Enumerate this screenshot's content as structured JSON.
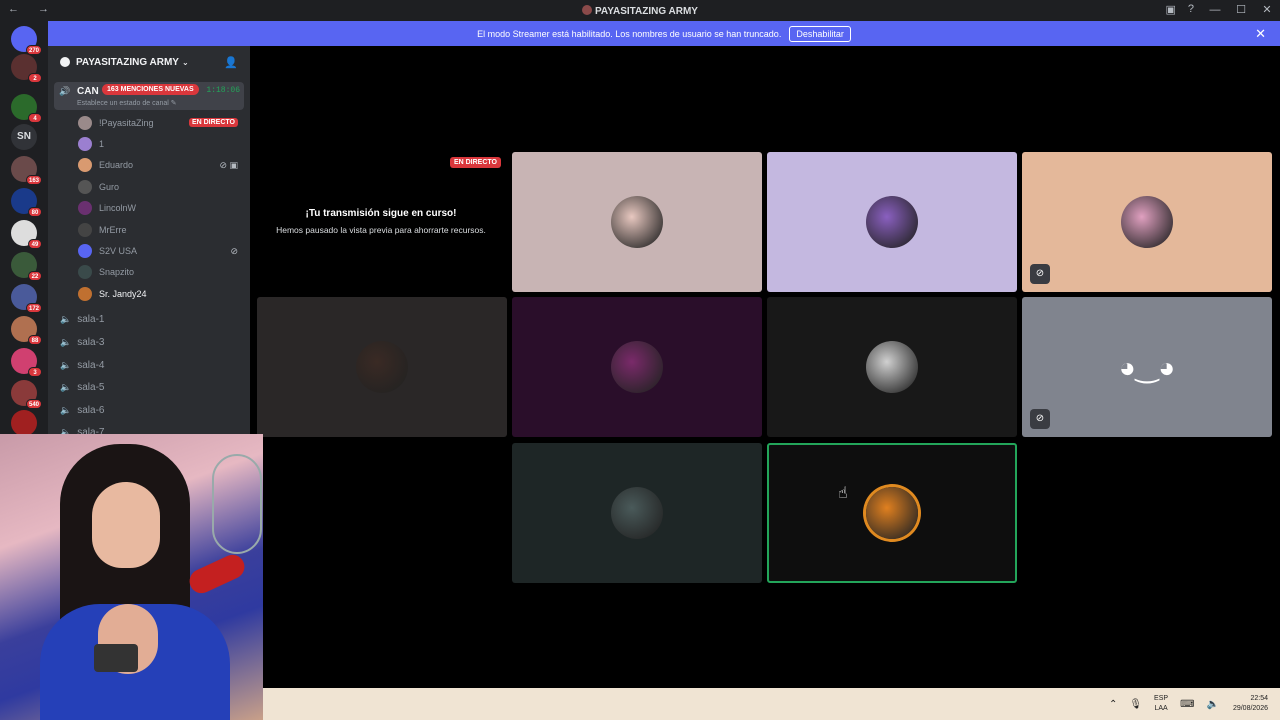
{
  "window": {
    "title": "PAYASITAZING ARMY",
    "nav": "← →"
  },
  "banner": {
    "text": "El modo Streamer está habilitado. Los nombres de usuario se han truncado.",
    "button": "Deshabilitar",
    "close": "✕"
  },
  "servers": [
    {
      "label": "",
      "badge": "270",
      "color": "#5865f2"
    },
    {
      "label": "",
      "badge": "2",
      "color": "#5a3030"
    },
    {
      "label": "",
      "badge": "4",
      "color": "#2b6a2b"
    },
    {
      "label": "SN",
      "badge": "",
      "color": "#313338"
    },
    {
      "label": "",
      "badge": "163",
      "color": "#6a4a4a"
    },
    {
      "label": "",
      "badge": "80",
      "color": "#1a3a8a"
    },
    {
      "label": "",
      "badge": "49",
      "color": "#dddddd"
    },
    {
      "label": "",
      "badge": "22",
      "color": "#3a5a3a"
    },
    {
      "label": "",
      "badge": "172",
      "color": "#4a5a9a"
    },
    {
      "label": "",
      "badge": "88",
      "color": "#b07050"
    },
    {
      "label": "",
      "badge": "3",
      "color": "#d04070"
    },
    {
      "label": "",
      "badge": "540",
      "color": "#8a3a3a"
    },
    {
      "label": "",
      "badge": "",
      "color": "#a02020"
    }
  ],
  "guild": {
    "name": "PAYASITAZING ARMY",
    "chevron": "⌄"
  },
  "active_channel": {
    "name": "CAN",
    "mentions": "163 MENCIONES NUEVAS",
    "timer": "1:18:06",
    "status": "Establece un estado de canal ✎"
  },
  "users": [
    {
      "name": "!PayasitaZing",
      "live": "EN DIRECTO",
      "icons": "",
      "color": "#9a8a8a"
    },
    {
      "name": "1",
      "live": "",
      "icons": "",
      "color": "#9b7fd0"
    },
    {
      "name": "Eduardo",
      "live": "",
      "icons": "⊘ ▣",
      "color": "#d99a70"
    },
    {
      "name": "Guro",
      "live": "",
      "icons": "",
      "color": "#555555"
    },
    {
      "name": "LincolnW",
      "live": "",
      "icons": "",
      "color": "#6a3070"
    },
    {
      "name": "MrErre",
      "live": "",
      "icons": "",
      "color": "#444444"
    },
    {
      "name": "S2V USA",
      "live": "",
      "icons": "⊘",
      "color": "#5865f2"
    },
    {
      "name": "Snapzito",
      "live": "",
      "icons": "",
      "color": "#3a4a4a"
    },
    {
      "name": "Sr. Jandy24",
      "live": "",
      "icons": "",
      "color": "#c07030"
    }
  ],
  "voice_channels": [
    "sala-1",
    "sala-3",
    "sala-4",
    "sala-5",
    "sala-6",
    "sala-7"
  ],
  "stream": {
    "badge": "EN DIRECTO",
    "heading": "¡Tu transmisión sigue en curso!",
    "subtext": "Hemos pausado la vista previa para ahorrarte recursos."
  },
  "tiles": [
    {
      "bg": "#c8b4b4",
      "avatar": "#e8c8c0",
      "muted": false,
      "speaking": false
    },
    {
      "bg": "#c4b8e0",
      "avatar": "#8a60c0",
      "muted": false,
      "speaking": false
    },
    {
      "bg": "#e4b89a",
      "avatar": "#e0a0c0",
      "muted": true,
      "speaking": false
    },
    {
      "bg": "#2a2727",
      "avatar": "#3a2a24",
      "muted": false,
      "speaking": false
    },
    {
      "bg": "#2a0e2a",
      "avatar": "#7a2a6a",
      "muted": false,
      "speaking": false
    },
    {
      "bg": "#181818",
      "avatar": "#d0d0d0",
      "muted": false,
      "speaking": false
    },
    {
      "bg": "#80848e",
      "avatar": "discord",
      "muted": true,
      "speaking": false
    },
    {
      "bg": "#1e2626",
      "avatar": "#4a5a5a",
      "muted": false,
      "speaking": false
    },
    {
      "bg": "#0e0e0e",
      "avatar": "#e08020",
      "muted": false,
      "speaking": true
    }
  ],
  "taskbar": {
    "lang_top": "ESP",
    "lang_bottom": "LAA",
    "time": "22:54",
    "date": "29/08/2026"
  }
}
